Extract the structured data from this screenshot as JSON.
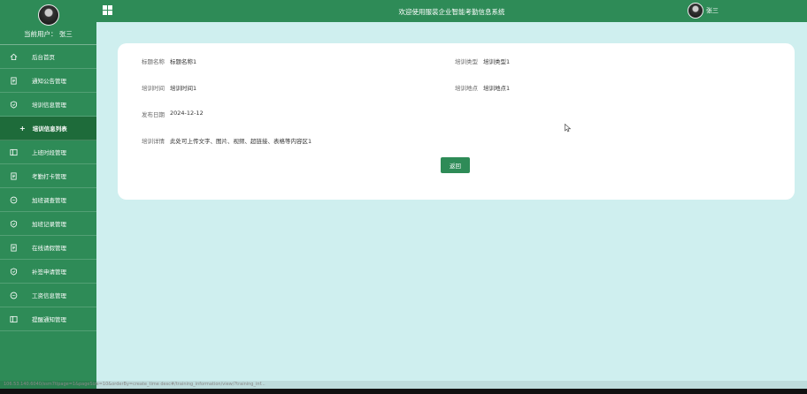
{
  "sidebar": {
    "current_user": "当前用户： 张三",
    "items": [
      {
        "label": "后台首页",
        "icon": "home-icon"
      },
      {
        "label": "通知公告管理",
        "icon": "document-icon"
      },
      {
        "label": "培训信息管理",
        "icon": "shield-check-icon"
      },
      {
        "label": "培训信息列表",
        "icon": "plus-icon",
        "active": true
      },
      {
        "label": "上班时段管理",
        "icon": "columns-icon"
      },
      {
        "label": "考勤打卡管理",
        "icon": "document-icon"
      },
      {
        "label": "加班调查管理",
        "icon": "chat-icon"
      },
      {
        "label": "加班记录管理",
        "icon": "shield-check-icon"
      },
      {
        "label": "在线请假管理",
        "icon": "document-icon"
      },
      {
        "label": "补签申请管理",
        "icon": "shield-check-icon"
      },
      {
        "label": "工资信息管理",
        "icon": "chat-icon"
      },
      {
        "label": "提醒通知管理",
        "icon": "columns-icon"
      }
    ]
  },
  "header": {
    "title": "欢迎使用服装企业智能考勤信息系统",
    "user_name": "张三"
  },
  "detail": {
    "title_label": "标题名称",
    "title_value": "标题名称1",
    "type_label": "培训类型",
    "type_value": "培训类型1",
    "time_label": "培训时间",
    "time_value": "培训时间1",
    "place_label": "培训地点",
    "place_value": "培训地点1",
    "date_label": "发布日期",
    "date_value": "2024-12-12",
    "content_label": "培训详情",
    "content_value": "此处可上传文字、图片、视频、超链接、表格等内容区1",
    "back_label": "返回"
  },
  "statusbar": {
    "url": "106.53.140.6040/ssm7tlpage=1&pageSize=10&orderBy=create_time desc#/training_information/view/?training_inf..."
  },
  "colors": {
    "primary": "#2e8b57",
    "background": "#cfefef"
  }
}
